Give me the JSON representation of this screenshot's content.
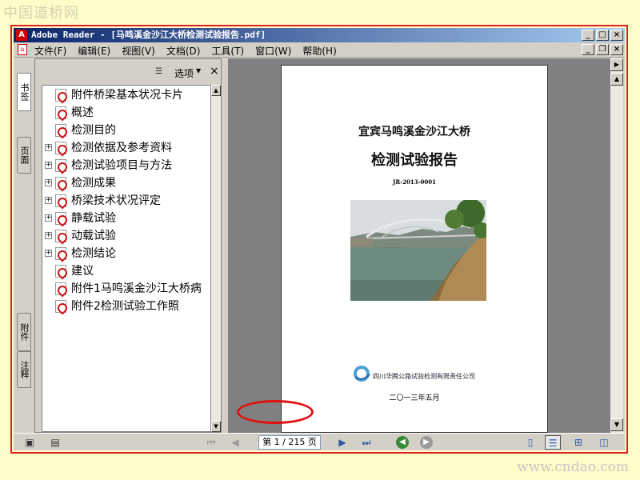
{
  "watermark": {
    "top": "中国道桥网",
    "bottom": "www.cndao.com"
  },
  "window": {
    "title": "Adobe Reader - [马鸣溪金沙江大桥检测试验报告.pdf]",
    "buttons": {
      "minimize": "_",
      "maximize": "□",
      "close": "×",
      "restore": "❐"
    }
  },
  "menu": [
    "文件(F)",
    "编辑(E)",
    "视图(V)",
    "文档(D)",
    "工具(T)",
    "窗口(W)",
    "帮助(H)"
  ],
  "side_tabs": [
    "书签",
    "页面",
    "附件",
    "注释"
  ],
  "nav_panel": {
    "options_label": "选项",
    "close": "×"
  },
  "bookmarks": [
    {
      "label": "附件桥梁基本状况卡片",
      "expandable": false
    },
    {
      "label": "概述",
      "expandable": false
    },
    {
      "label": "检测目的",
      "expandable": false
    },
    {
      "label": "检测依据及参考资料",
      "expandable": true
    },
    {
      "label": "检测试验项目与方法",
      "expandable": true
    },
    {
      "label": "检测成果",
      "expandable": true
    },
    {
      "label": "桥梁技术状况评定",
      "expandable": true
    },
    {
      "label": "静载试验",
      "expandable": true
    },
    {
      "label": "动载试验",
      "expandable": true
    },
    {
      "label": "检测结论",
      "expandable": true
    },
    {
      "label": "建议",
      "expandable": false
    },
    {
      "label": "附件1马鸣溪金沙江大桥病",
      "expandable": false
    },
    {
      "label": "附件2检测试验工作照",
      "expandable": false
    }
  ],
  "document_page": {
    "line1": "宜宾马鸣溪金沙江大桥",
    "line2": "检测试验报告",
    "code": "JR-2013-0001",
    "company": "四川华腾公路试验检测有限责任公司",
    "date": "二〇一三年五月"
  },
  "status": {
    "page_display": "第 1 / 215 页",
    "current_page": 1,
    "total_pages": 215
  },
  "colors": {
    "frame": "#e02020",
    "titlebar_start": "#0a246a",
    "titlebar_end": "#a6caf0",
    "highlight_oval": "#e01010"
  }
}
